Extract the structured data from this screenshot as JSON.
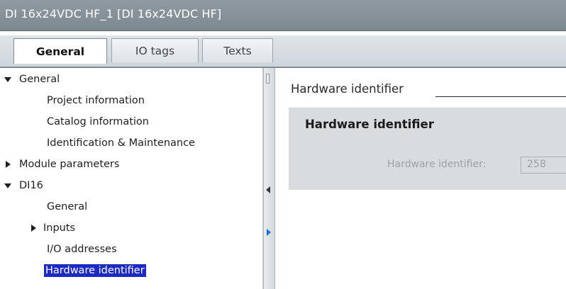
{
  "window": {
    "title": "DI 16x24VDC HF_1 [DI 16x24VDC HF]"
  },
  "tabs": [
    {
      "label": "General",
      "active": true
    },
    {
      "label": "IO tags",
      "active": false
    },
    {
      "label": "Texts",
      "active": false
    }
  ],
  "nav": {
    "items": [
      {
        "label": "General",
        "expander": "expanded-triangle-icon"
      },
      {
        "label": "Project information",
        "expander": null
      },
      {
        "label": "Catalog information",
        "expander": null
      },
      {
        "label": "Identification & Maintenance",
        "expander": null
      },
      {
        "label": "Module parameters",
        "expander": "collapsed-triangle-icon"
      },
      {
        "label": "DI16",
        "expander": "expanded-triangle-icon"
      },
      {
        "label": "General",
        "expander": null
      },
      {
        "label": "Inputs",
        "expander": "collapsed-triangle-icon"
      },
      {
        "label": "I/O addresses",
        "expander": null
      },
      {
        "label": "Hardware identifier",
        "expander": null,
        "selected": true
      }
    ],
    "selection_color": "#1c29c3"
  },
  "content": {
    "section_heading": "Hardware identifier",
    "panel": {
      "title": "Hardware identifier",
      "field_label": "Hardware identifier:",
      "field_value": "258"
    }
  }
}
